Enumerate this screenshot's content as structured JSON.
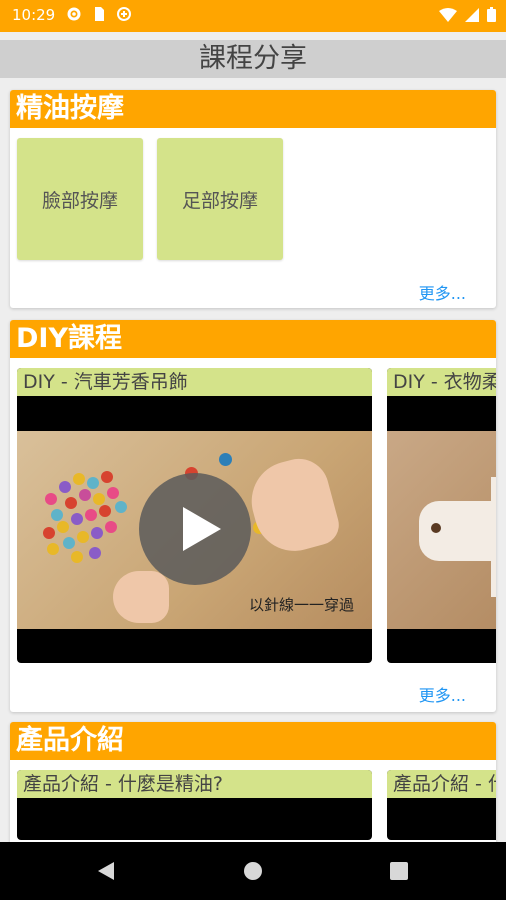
{
  "status_bar": {
    "time": "10:29",
    "bg_color": "#ffa500"
  },
  "app_bar": {
    "title": "課程分享"
  },
  "sections": {
    "essential_oil": {
      "title": "精油按摩",
      "items": [
        "臉部按摩",
        "足部按摩"
      ],
      "more": "更多..."
    },
    "diy": {
      "title": "DIY課程",
      "videos": [
        {
          "title": "DIY - 汽車芳香吊飾",
          "caption": "以針線一一穿過"
        },
        {
          "title": "DIY - 衣物柔"
        }
      ],
      "more": "更多..."
    },
    "products": {
      "title": "產品介紹",
      "videos": [
        {
          "title": "產品介紹 - 什麼是精油?"
        },
        {
          "title": "產品介紹 - 什"
        }
      ]
    }
  },
  "colors": {
    "accent": "#ffa500",
    "tile": "#d4e38a",
    "link": "#2196f3"
  }
}
